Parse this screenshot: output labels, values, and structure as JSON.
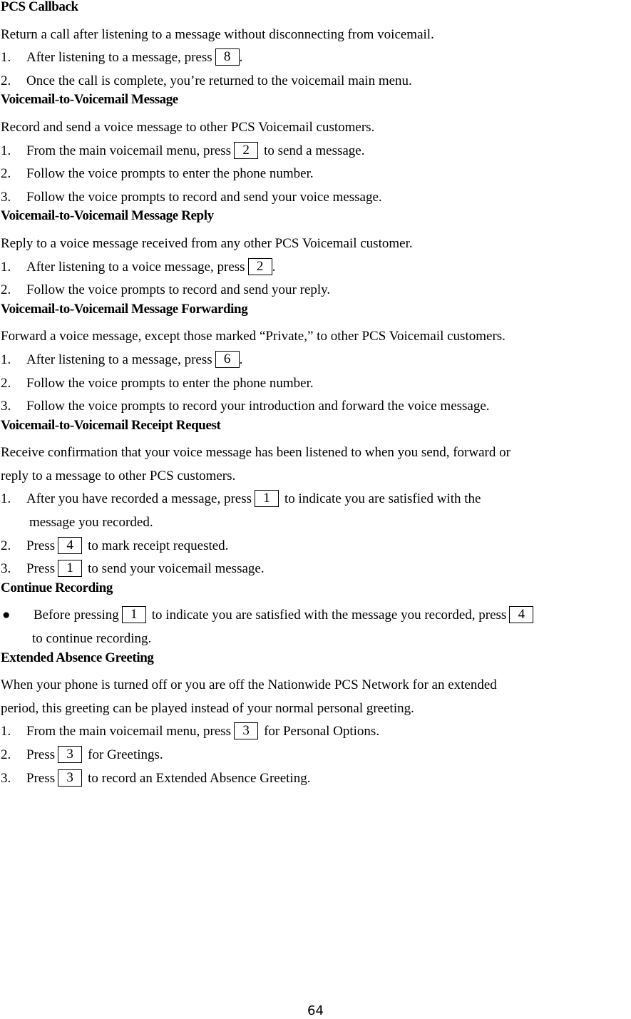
{
  "sections": [
    {
      "heading": "PCS Callback",
      "description": [
        "Return a call after listening to a message without disconnecting from voicemail."
      ],
      "steps": [
        {
          "num": "1.",
          "before": "After listening to a message, press",
          "key": "8",
          "after": "."
        },
        {
          "num": "2.",
          "text": "Once the call is complete, you’re returned to the voicemail main menu."
        }
      ]
    },
    {
      "heading": "Voicemail-to-Voicemail Message",
      "description": [
        "Record and send a voice message to other PCS Voicemail customers."
      ],
      "steps": [
        {
          "num": "1.",
          "before": "From the main voicemail menu, press",
          "key": "2",
          "after": "to send a message."
        },
        {
          "num": "2.",
          "text": "Follow the voice prompts to enter the phone number."
        },
        {
          "num": "3.",
          "text": "Follow the voice prompts to record and send your voice message."
        }
      ]
    },
    {
      "heading": "Voicemail-to-Voicemail Message Reply",
      "description": [
        "Reply to a voice message received from any other PCS Voicemail customer."
      ],
      "steps": [
        {
          "num": "1.",
          "before": "After listening to a voice message, press",
          "key": "2",
          "after": "."
        },
        {
          "num": "2.",
          "text": "Follow the voice prompts to record and send your reply."
        }
      ]
    },
    {
      "heading": "Voicemail-to-Voicemail Message Forwarding",
      "description": [
        "Forward a voice message, except those marked “Private,” to other PCS Voicemail customers."
      ],
      "steps": [
        {
          "num": "1.",
          "before": "After listening to a message, press",
          "key": "6",
          "after": "."
        },
        {
          "num": "2.",
          "text": "Follow the voice prompts to enter the phone number."
        },
        {
          "num": "3.",
          "text": "Follow the voice prompts to record your introduction and forward the voice message."
        }
      ]
    },
    {
      "heading": "Voicemail-to-Voicemail Receipt Request",
      "description": [
        "Receive confirmation that your voice message has been listened to when you send, forward or",
        "reply to a message to other PCS customers."
      ],
      "steps": [
        {
          "num": "1.",
          "before": "After you have recorded a message, press",
          "key": "1",
          "after": "to indicate you are satisfied with the",
          "continuation": "message you recorded."
        },
        {
          "num": "2.",
          "before": "Press",
          "key": "4",
          "after": "to mark receipt requested."
        },
        {
          "num": "3.",
          "before": "Press",
          "key": "1",
          "after": "to send your voicemail message."
        }
      ]
    },
    {
      "heading": "Continue Recording",
      "bullet": {
        "before": "Before pressing",
        "key1": "1",
        "middle": "to indicate you are satisfied with the message you recorded, press",
        "key2": "4",
        "continuation": "to continue recording."
      }
    },
    {
      "heading": "Extended Absence Greeting",
      "description": [
        "When your phone is turned off or you are off the Nationwide PCS Network for an extended",
        "period, this greeting can be played instead of your normal personal greeting."
      ],
      "steps": [
        {
          "num": "1.",
          "before": "From the main voicemail menu, press",
          "key": "3",
          "after": "for Personal Options."
        },
        {
          "num": "2.",
          "before": "Press",
          "key": "3",
          "after": "for Greetings."
        },
        {
          "num": "3.",
          "before": "Press",
          "key": "3",
          "after": "to record an Extended Absence Greeting."
        }
      ]
    }
  ],
  "page_number": "64"
}
